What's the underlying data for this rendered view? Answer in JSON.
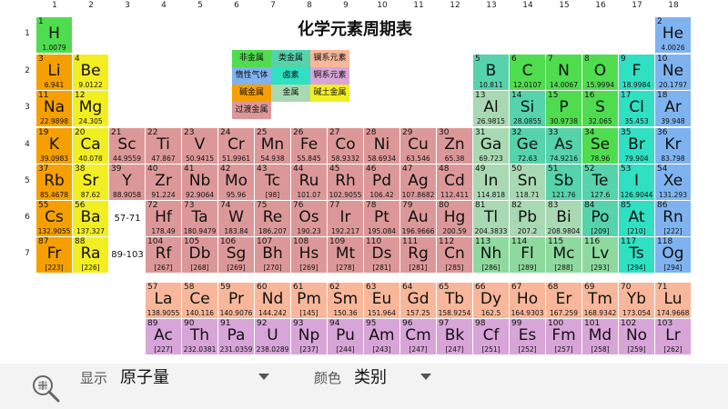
{
  "title": "化学元素周期表",
  "group_numbers": [
    "1",
    "2",
    "3",
    "4",
    "5",
    "6",
    "7",
    "8",
    "9",
    "10",
    "11",
    "12",
    "13",
    "14",
    "15",
    "16",
    "17",
    "18"
  ],
  "period_numbers": [
    "1",
    "2",
    "3",
    "4",
    "5",
    "6",
    "7"
  ],
  "colors": {
    "nonmetal": "#4fdc4f",
    "alkali": "#f5a000",
    "alkaline": "#f3ee22",
    "metalloid": "#56d3ab",
    "halogen": "#2fe0c3",
    "noble": "#7fb3f0",
    "post_transition": "#a9d9b3",
    "transition": "#dc9898",
    "lanthanide": "#f8b79a",
    "actinide": "#d8a5d8",
    "unknown": "#8ed99e"
  },
  "legend": [
    {
      "label": "非金属",
      "category": "nonmetal"
    },
    {
      "label": "类金属",
      "category": "metalloid"
    },
    {
      "label": "镧系元素",
      "category": "lanthanide"
    },
    {
      "label": "惰性气体",
      "category": "noble"
    },
    {
      "label": "卤素",
      "category": "halogen"
    },
    {
      "label": "锕系元素",
      "category": "actinide"
    },
    {
      "label": "碱金属",
      "category": "alkali"
    },
    {
      "label": "金属",
      "category": "post_transition"
    },
    {
      "label": "碱土金属",
      "category": "alkaline"
    },
    {
      "label": "过渡金属",
      "category": "transition"
    }
  ],
  "range_labels": {
    "lanthanides": "57-71",
    "actinides": "89-103"
  },
  "elements": [
    {
      "z": "1",
      "s": "H",
      "m": "1.0079",
      "c": "nonmetal",
      "p": 1,
      "g": 1
    },
    {
      "z": "2",
      "s": "He",
      "m": "4.0026",
      "c": "noble",
      "p": 1,
      "g": 18
    },
    {
      "z": "3",
      "s": "Li",
      "m": "6.941",
      "c": "alkali",
      "p": 2,
      "g": 1
    },
    {
      "z": "4",
      "s": "Be",
      "m": "9.0122",
      "c": "alkaline",
      "p": 2,
      "g": 2
    },
    {
      "z": "5",
      "s": "B",
      "m": "10.811",
      "c": "metalloid",
      "p": 2,
      "g": 13
    },
    {
      "z": "6",
      "s": "C",
      "m": "12.0107",
      "c": "nonmetal",
      "p": 2,
      "g": 14
    },
    {
      "z": "7",
      "s": "N",
      "m": "14.0067",
      "c": "nonmetal",
      "p": 2,
      "g": 15
    },
    {
      "z": "8",
      "s": "O",
      "m": "15.9994",
      "c": "nonmetal",
      "p": 2,
      "g": 16
    },
    {
      "z": "9",
      "s": "F",
      "m": "18.9984",
      "c": "halogen",
      "p": 2,
      "g": 17
    },
    {
      "z": "10",
      "s": "Ne",
      "m": "20.1797",
      "c": "noble",
      "p": 2,
      "g": 18
    },
    {
      "z": "11",
      "s": "Na",
      "m": "22.9898",
      "c": "alkali",
      "p": 3,
      "g": 1
    },
    {
      "z": "12",
      "s": "Mg",
      "m": "24.305",
      "c": "alkaline",
      "p": 3,
      "g": 2
    },
    {
      "z": "13",
      "s": "Al",
      "m": "26.9815",
      "c": "post_transition",
      "p": 3,
      "g": 13
    },
    {
      "z": "14",
      "s": "Si",
      "m": "28.0855",
      "c": "metalloid",
      "p": 3,
      "g": 14
    },
    {
      "z": "15",
      "s": "P",
      "m": "30.9738",
      "c": "nonmetal",
      "p": 3,
      "g": 15
    },
    {
      "z": "16",
      "s": "S",
      "m": "32.065",
      "c": "nonmetal",
      "p": 3,
      "g": 16
    },
    {
      "z": "17",
      "s": "Cl",
      "m": "35.453",
      "c": "halogen",
      "p": 3,
      "g": 17
    },
    {
      "z": "18",
      "s": "Ar",
      "m": "39.948",
      "c": "noble",
      "p": 3,
      "g": 18
    },
    {
      "z": "19",
      "s": "K",
      "m": "39.0983",
      "c": "alkali",
      "p": 4,
      "g": 1
    },
    {
      "z": "20",
      "s": "Ca",
      "m": "40.078",
      "c": "alkaline",
      "p": 4,
      "g": 2
    },
    {
      "z": "21",
      "s": "Sc",
      "m": "44.9559",
      "c": "transition",
      "p": 4,
      "g": 3
    },
    {
      "z": "22",
      "s": "Ti",
      "m": "47.867",
      "c": "transition",
      "p": 4,
      "g": 4
    },
    {
      "z": "23",
      "s": "V",
      "m": "50.9415",
      "c": "transition",
      "p": 4,
      "g": 5
    },
    {
      "z": "24",
      "s": "Cr",
      "m": "51.9961",
      "c": "transition",
      "p": 4,
      "g": 6
    },
    {
      "z": "25",
      "s": "Mn",
      "m": "54.938",
      "c": "transition",
      "p": 4,
      "g": 7
    },
    {
      "z": "26",
      "s": "Fe",
      "m": "55.845",
      "c": "transition",
      "p": 4,
      "g": 8
    },
    {
      "z": "27",
      "s": "Co",
      "m": "58.9332",
      "c": "transition",
      "p": 4,
      "g": 9
    },
    {
      "z": "28",
      "s": "Ni",
      "m": "58.6934",
      "c": "transition",
      "p": 4,
      "g": 10
    },
    {
      "z": "29",
      "s": "Cu",
      "m": "63.546",
      "c": "transition",
      "p": 4,
      "g": 11
    },
    {
      "z": "30",
      "s": "Zn",
      "m": "65.38",
      "c": "transition",
      "p": 4,
      "g": 12
    },
    {
      "z": "31",
      "s": "Ga",
      "m": "69.723",
      "c": "post_transition",
      "p": 4,
      "g": 13
    },
    {
      "z": "32",
      "s": "Ge",
      "m": "72.63",
      "c": "metalloid",
      "p": 4,
      "g": 14
    },
    {
      "z": "33",
      "s": "As",
      "m": "74.9216",
      "c": "metalloid",
      "p": 4,
      "g": 15
    },
    {
      "z": "34",
      "s": "Se",
      "m": "78.96",
      "c": "nonmetal",
      "p": 4,
      "g": 16
    },
    {
      "z": "35",
      "s": "Br",
      "m": "79.904",
      "c": "halogen",
      "p": 4,
      "g": 17
    },
    {
      "z": "36",
      "s": "Kr",
      "m": "83.798",
      "c": "noble",
      "p": 4,
      "g": 18
    },
    {
      "z": "37",
      "s": "Rb",
      "m": "85.4678",
      "c": "alkali",
      "p": 5,
      "g": 1
    },
    {
      "z": "38",
      "s": "Sr",
      "m": "87.62",
      "c": "alkaline",
      "p": 5,
      "g": 2
    },
    {
      "z": "39",
      "s": "Y",
      "m": "88.9058",
      "c": "transition",
      "p": 5,
      "g": 3
    },
    {
      "z": "40",
      "s": "Zr",
      "m": "91.224",
      "c": "transition",
      "p": 5,
      "g": 4
    },
    {
      "z": "41",
      "s": "Nb",
      "m": "92.9064",
      "c": "transition",
      "p": 5,
      "g": 5
    },
    {
      "z": "42",
      "s": "Mo",
      "m": "95.96",
      "c": "transition",
      "p": 5,
      "g": 6
    },
    {
      "z": "43",
      "s": "Tc",
      "m": "[98]",
      "c": "transition",
      "p": 5,
      "g": 7
    },
    {
      "z": "44",
      "s": "Ru",
      "m": "101.07",
      "c": "transition",
      "p": 5,
      "g": 8
    },
    {
      "z": "45",
      "s": "Rh",
      "m": "102.9055",
      "c": "transition",
      "p": 5,
      "g": 9
    },
    {
      "z": "46",
      "s": "Pd",
      "m": "106.42",
      "c": "transition",
      "p": 5,
      "g": 10
    },
    {
      "z": "47",
      "s": "Ag",
      "m": "107.8682",
      "c": "transition",
      "p": 5,
      "g": 11
    },
    {
      "z": "48",
      "s": "Cd",
      "m": "112.411",
      "c": "transition",
      "p": 5,
      "g": 12
    },
    {
      "z": "49",
      "s": "In",
      "m": "114.818",
      "c": "post_transition",
      "p": 5,
      "g": 13
    },
    {
      "z": "50",
      "s": "Sn",
      "m": "118.71",
      "c": "post_transition",
      "p": 5,
      "g": 14
    },
    {
      "z": "51",
      "s": "Sb",
      "m": "121.76",
      "c": "metalloid",
      "p": 5,
      "g": 15
    },
    {
      "z": "52",
      "s": "Te",
      "m": "127.6",
      "c": "metalloid",
      "p": 5,
      "g": 16
    },
    {
      "z": "53",
      "s": "I",
      "m": "126.9044",
      "c": "halogen",
      "p": 5,
      "g": 17
    },
    {
      "z": "54",
      "s": "Xe",
      "m": "131.293",
      "c": "noble",
      "p": 5,
      "g": 18
    },
    {
      "z": "55",
      "s": "Cs",
      "m": "132.9055",
      "c": "alkali",
      "p": 6,
      "g": 1
    },
    {
      "z": "56",
      "s": "Ba",
      "m": "137.327",
      "c": "alkaline",
      "p": 6,
      "g": 2
    },
    {
      "z": "72",
      "s": "Hf",
      "m": "178.49",
      "c": "transition",
      "p": 6,
      "g": 4
    },
    {
      "z": "73",
      "s": "Ta",
      "m": "180.9479",
      "c": "transition",
      "p": 6,
      "g": 5
    },
    {
      "z": "74",
      "s": "W",
      "m": "183.84",
      "c": "transition",
      "p": 6,
      "g": 6
    },
    {
      "z": "75",
      "s": "Re",
      "m": "186.207",
      "c": "transition",
      "p": 6,
      "g": 7
    },
    {
      "z": "76",
      "s": "Os",
      "m": "190.23",
      "c": "transition",
      "p": 6,
      "g": 8
    },
    {
      "z": "77",
      "s": "Ir",
      "m": "192.217",
      "c": "transition",
      "p": 6,
      "g": 9
    },
    {
      "z": "78",
      "s": "Pt",
      "m": "195.084",
      "c": "transition",
      "p": 6,
      "g": 10
    },
    {
      "z": "79",
      "s": "Au",
      "m": "196.9666",
      "c": "transition",
      "p": 6,
      "g": 11
    },
    {
      "z": "80",
      "s": "Hg",
      "m": "200.59",
      "c": "transition",
      "p": 6,
      "g": 12
    },
    {
      "z": "81",
      "s": "Tl",
      "m": "204.3833",
      "c": "post_transition",
      "p": 6,
      "g": 13
    },
    {
      "z": "82",
      "s": "Pb",
      "m": "207.2",
      "c": "post_transition",
      "p": 6,
      "g": 14
    },
    {
      "z": "83",
      "s": "Bi",
      "m": "208.9804",
      "c": "post_transition",
      "p": 6,
      "g": 15
    },
    {
      "z": "84",
      "s": "Po",
      "m": "[209]",
      "c": "metalloid",
      "p": 6,
      "g": 16
    },
    {
      "z": "85",
      "s": "At",
      "m": "[210]",
      "c": "halogen",
      "p": 6,
      "g": 17
    },
    {
      "z": "86",
      "s": "Rn",
      "m": "[222]",
      "c": "noble",
      "p": 6,
      "g": 18
    },
    {
      "z": "87",
      "s": "Fr",
      "m": "[223]",
      "c": "alkali",
      "p": 7,
      "g": 1
    },
    {
      "z": "88",
      "s": "Ra",
      "m": "[226]",
      "c": "alkaline",
      "p": 7,
      "g": 2
    },
    {
      "z": "104",
      "s": "Rf",
      "m": "[267]",
      "c": "transition",
      "p": 7,
      "g": 4
    },
    {
      "z": "105",
      "s": "Db",
      "m": "[268]",
      "c": "transition",
      "p": 7,
      "g": 5
    },
    {
      "z": "106",
      "s": "Sg",
      "m": "[269]",
      "c": "transition",
      "p": 7,
      "g": 6
    },
    {
      "z": "107",
      "s": "Bh",
      "m": "[270]",
      "c": "transition",
      "p": 7,
      "g": 7
    },
    {
      "z": "108",
      "s": "Hs",
      "m": "[269]",
      "c": "transition",
      "p": 7,
      "g": 8
    },
    {
      "z": "109",
      "s": "Mt",
      "m": "[278]",
      "c": "transition",
      "p": 7,
      "g": 9
    },
    {
      "z": "110",
      "s": "Ds",
      "m": "[281]",
      "c": "transition",
      "p": 7,
      "g": 10
    },
    {
      "z": "111",
      "s": "Rg",
      "m": "[281]",
      "c": "transition",
      "p": 7,
      "g": 11
    },
    {
      "z": "112",
      "s": "Cn",
      "m": "[285]",
      "c": "transition",
      "p": 7,
      "g": 12
    },
    {
      "z": "113",
      "s": "Nh",
      "m": "[286]",
      "c": "unknown",
      "p": 7,
      "g": 13
    },
    {
      "z": "114",
      "s": "Fl",
      "m": "[289]",
      "c": "unknown",
      "p": 7,
      "g": 14
    },
    {
      "z": "115",
      "s": "Mc",
      "m": "[288]",
      "c": "unknown",
      "p": 7,
      "g": 15
    },
    {
      "z": "116",
      "s": "Lv",
      "m": "[293]",
      "c": "unknown",
      "p": 7,
      "g": 16
    },
    {
      "z": "117",
      "s": "Ts",
      "m": "[294]",
      "c": "halogen",
      "p": 7,
      "g": 17
    },
    {
      "z": "118",
      "s": "Og",
      "m": "[294]",
      "c": "noble",
      "p": 7,
      "g": 18
    },
    {
      "z": "57",
      "s": "La",
      "m": "138.9055",
      "c": "lanthanide",
      "p": 8,
      "g": 4
    },
    {
      "z": "58",
      "s": "Ce",
      "m": "140.116",
      "c": "lanthanide",
      "p": 8,
      "g": 5
    },
    {
      "z": "59",
      "s": "Pr",
      "m": "140.9076",
      "c": "lanthanide",
      "p": 8,
      "g": 6
    },
    {
      "z": "60",
      "s": "Nd",
      "m": "144.242",
      "c": "lanthanide",
      "p": 8,
      "g": 7
    },
    {
      "z": "61",
      "s": "Pm",
      "m": "[145]",
      "c": "lanthanide",
      "p": 8,
      "g": 8
    },
    {
      "z": "62",
      "s": "Sm",
      "m": "150.36",
      "c": "lanthanide",
      "p": 8,
      "g": 9
    },
    {
      "z": "63",
      "s": "Eu",
      "m": "151.964",
      "c": "lanthanide",
      "p": 8,
      "g": 10
    },
    {
      "z": "64",
      "s": "Gd",
      "m": "157.25",
      "c": "lanthanide",
      "p": 8,
      "g": 11
    },
    {
      "z": "65",
      "s": "Tb",
      "m": "158.9254",
      "c": "lanthanide",
      "p": 8,
      "g": 12
    },
    {
      "z": "66",
      "s": "Dy",
      "m": "162.5",
      "c": "lanthanide",
      "p": 8,
      "g": 13
    },
    {
      "z": "67",
      "s": "Ho",
      "m": "164.9303",
      "c": "lanthanide",
      "p": 8,
      "g": 14
    },
    {
      "z": "68",
      "s": "Er",
      "m": "167.259",
      "c": "lanthanide",
      "p": 8,
      "g": 15
    },
    {
      "z": "69",
      "s": "Tm",
      "m": "168.9342",
      "c": "lanthanide",
      "p": 8,
      "g": 16
    },
    {
      "z": "70",
      "s": "Yb",
      "m": "173.054",
      "c": "lanthanide",
      "p": 8,
      "g": 17
    },
    {
      "z": "71",
      "s": "Lu",
      "m": "174.9668",
      "c": "lanthanide",
      "p": 8,
      "g": 18
    },
    {
      "z": "89",
      "s": "Ac",
      "m": "[227]",
      "c": "actinide",
      "p": 9,
      "g": 4
    },
    {
      "z": "90",
      "s": "Th",
      "m": "232.0381",
      "c": "actinide",
      "p": 9,
      "g": 5
    },
    {
      "z": "91",
      "s": "Pa",
      "m": "231.0359",
      "c": "actinide",
      "p": 9,
      "g": 6
    },
    {
      "z": "92",
      "s": "U",
      "m": "238.0289",
      "c": "actinide",
      "p": 9,
      "g": 7
    },
    {
      "z": "93",
      "s": "Np",
      "m": "[237]",
      "c": "actinide",
      "p": 9,
      "g": 8
    },
    {
      "z": "94",
      "s": "Pu",
      "m": "[244]",
      "c": "actinide",
      "p": 9,
      "g": 9
    },
    {
      "z": "95",
      "s": "Am",
      "m": "[243]",
      "c": "actinide",
      "p": 9,
      "g": 10
    },
    {
      "z": "96",
      "s": "Cm",
      "m": "[247]",
      "c": "actinide",
      "p": 9,
      "g": 11
    },
    {
      "z": "97",
      "s": "Bk",
      "m": "[247]",
      "c": "actinide",
      "p": 9,
      "g": 12
    },
    {
      "z": "98",
      "s": "Cf",
      "m": "[251]",
      "c": "actinide",
      "p": 9,
      "g": 13
    },
    {
      "z": "99",
      "s": "Es",
      "m": "[252]",
      "c": "actinide",
      "p": 9,
      "g": 14
    },
    {
      "z": "100",
      "s": "Fm",
      "m": "[257]",
      "c": "actinide",
      "p": 9,
      "g": 15
    },
    {
      "z": "101",
      "s": "Md",
      "m": "[258]",
      "c": "actinide",
      "p": 9,
      "g": 16
    },
    {
      "z": "102",
      "s": "No",
      "m": "[259]",
      "c": "actinide",
      "p": 9,
      "g": 17
    },
    {
      "z": "103",
      "s": "Lr",
      "m": "[262]",
      "c": "actinide",
      "p": 9,
      "g": 18
    }
  ],
  "bottom_bar": {
    "display_label": "显示",
    "display_value": "原子量",
    "color_label": "颜色",
    "color_value": "类别",
    "zoom_icon": "zoom-icon",
    "dropdown_icon": "dropdown-arrow-icon"
  }
}
